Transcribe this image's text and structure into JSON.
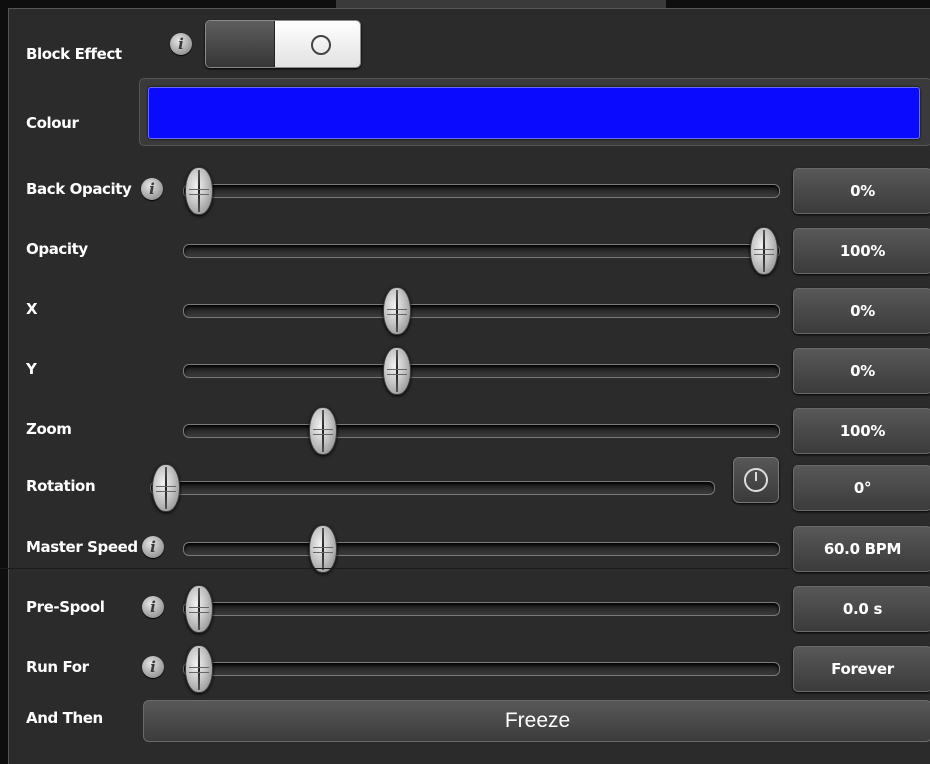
{
  "block_effect": {
    "label": "Block Effect",
    "info_glyph": "i",
    "toggle_state": "on"
  },
  "colour": {
    "label": "Colour",
    "value": "#0a0aff"
  },
  "sliders": [
    {
      "label": "Back Opacity",
      "value_text": "0%",
      "position": 0.0,
      "has_info": true
    },
    {
      "label": "Opacity",
      "value_text": "100%",
      "position": 1.0,
      "has_info": false
    },
    {
      "label": "X",
      "value_text": "0%",
      "position": 0.35,
      "has_info": false
    },
    {
      "label": "Y",
      "value_text": "0%",
      "position": 0.35,
      "has_info": false
    },
    {
      "label": "Zoom",
      "value_text": "100%",
      "position": 0.22,
      "has_info": false
    },
    {
      "label": "Rotation",
      "value_text": "0°",
      "position": 0.0,
      "has_info": false,
      "has_clock_button": true
    },
    {
      "label": "Master Speed",
      "value_text": "60.0 BPM",
      "position": 0.22,
      "has_info": true
    },
    {
      "label": "Pre-Spool",
      "value_text": "0.0 s",
      "position": 0.0,
      "has_info": true
    },
    {
      "label": "Run For",
      "value_text": "Forever",
      "position": 0.0,
      "has_info": true
    }
  ],
  "and_then": {
    "label": "And Then",
    "button": "Freeze"
  },
  "icons": {
    "info": "info-icon",
    "clock": "clock-icon"
  }
}
